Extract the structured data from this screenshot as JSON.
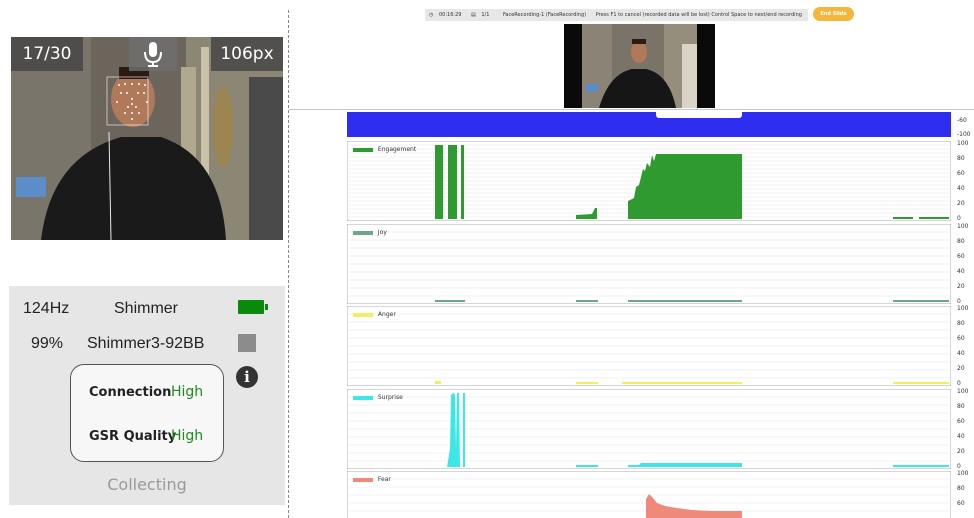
{
  "camera": {
    "frame_count": "17/30",
    "mic_icon": "microphone-icon",
    "pixel_size": "106px"
  },
  "shimmer": {
    "rate": "124Hz",
    "name": "Shimmer",
    "battery_percent": "99%",
    "device_id": "Shimmer3-92BB",
    "battery_icon": "battery-icon",
    "info_icon": "info-icon",
    "connection_label": "Connection",
    "connection_value": "High",
    "gsr_label": "GSR Quality",
    "gsr_value": "High",
    "status": "Collecting",
    "status_color": "#1d8a1d"
  },
  "topbar": {
    "time": "00:16:29",
    "slide": "1/1",
    "recording": "FaceRecording-1 (FaceRecording)",
    "instructions": "Press   F1 to cancel (recorded data will be lost)  Control  Space to next/end recording",
    "end_slide_label": "End Slide"
  },
  "blue_bar": {
    "ticks": [
      "-60",
      "-100"
    ],
    "color": "#2f2ef0"
  },
  "charts": [
    {
      "name": "Engagement",
      "color": "#2f9a2f",
      "ticks": [
        "100",
        "80",
        "60",
        "40",
        "20",
        "0"
      ]
    },
    {
      "name": "Joy",
      "color": "#6aa88a",
      "ticks": [
        "100",
        "80",
        "60",
        "40",
        "20",
        "0"
      ]
    },
    {
      "name": "Anger",
      "color": "#f2ef5e",
      "ticks": [
        "100",
        "80",
        "60",
        "40",
        "20",
        "0"
      ]
    },
    {
      "name": "Surprise",
      "color": "#3fe6e6",
      "ticks": [
        "100",
        "80",
        "60",
        "40",
        "20",
        "0"
      ]
    },
    {
      "name": "Fear",
      "color": "#ef8a7a",
      "ticks": [
        "100",
        "80",
        "60"
      ]
    }
  ]
}
